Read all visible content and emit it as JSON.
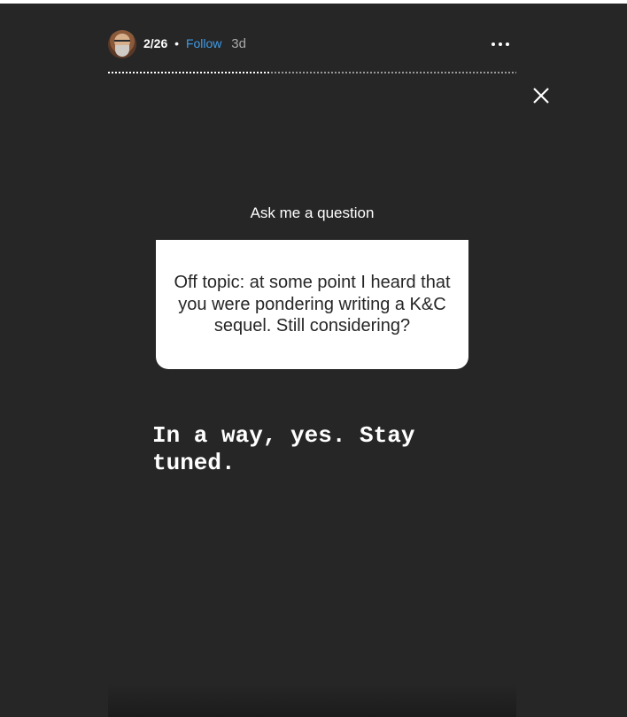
{
  "header": {
    "username": "2/26",
    "separator": "•",
    "follow_label": "Follow",
    "time_ago": "3d"
  },
  "progress": {
    "segment_fraction": 0.4
  },
  "question": {
    "prompt": "Ask me a question",
    "text": "Off topic: at some point I heard that you were pondering writing a K&C sequel. Still considering?"
  },
  "answer": {
    "text": "In a way, yes. Stay tuned."
  },
  "colors": {
    "background": "#262626",
    "follow": "#3f9be6",
    "card": "#ffffff"
  },
  "icons": {
    "more": "more-options-icon",
    "close": "close-icon"
  }
}
